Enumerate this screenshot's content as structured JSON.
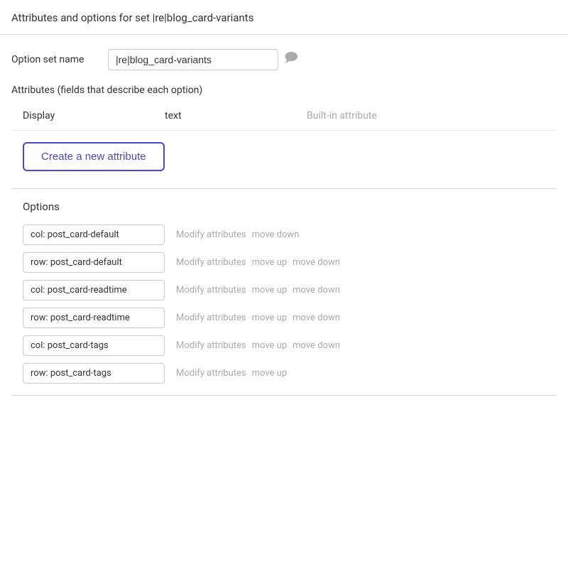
{
  "page": {
    "title": "Attributes and options for set |re|blog_card-variants"
  },
  "option_set": {
    "field_label": "Option set name",
    "name_value": "|re|blog_card-variants",
    "comment_icon": "💬"
  },
  "attributes": {
    "section_label": "Attributes (fields that describe each option)",
    "columns": {
      "display": "Display",
      "type": "text",
      "builtin": "Built-in attribute"
    },
    "create_button": "Create a new attribute"
  },
  "options": {
    "title": "Options",
    "items": [
      {
        "label": "col: post_card-default",
        "actions": [
          "Modify attributes",
          "move down"
        ]
      },
      {
        "label": "row: post_card-default",
        "actions": [
          "Modify attributes",
          "move up",
          "move down"
        ]
      },
      {
        "label": "col: post_card-readtime",
        "actions": [
          "Modify attributes",
          "move up",
          "move down"
        ]
      },
      {
        "label": "row: post_card-readtime",
        "actions": [
          "Modify attributes",
          "move up",
          "move down"
        ]
      },
      {
        "label": "col: post_card-tags",
        "actions": [
          "Modify attributes",
          "move up",
          "move down"
        ]
      },
      {
        "label": "row: post_card-tags",
        "actions": [
          "Modify attributes",
          "move up"
        ]
      }
    ]
  }
}
